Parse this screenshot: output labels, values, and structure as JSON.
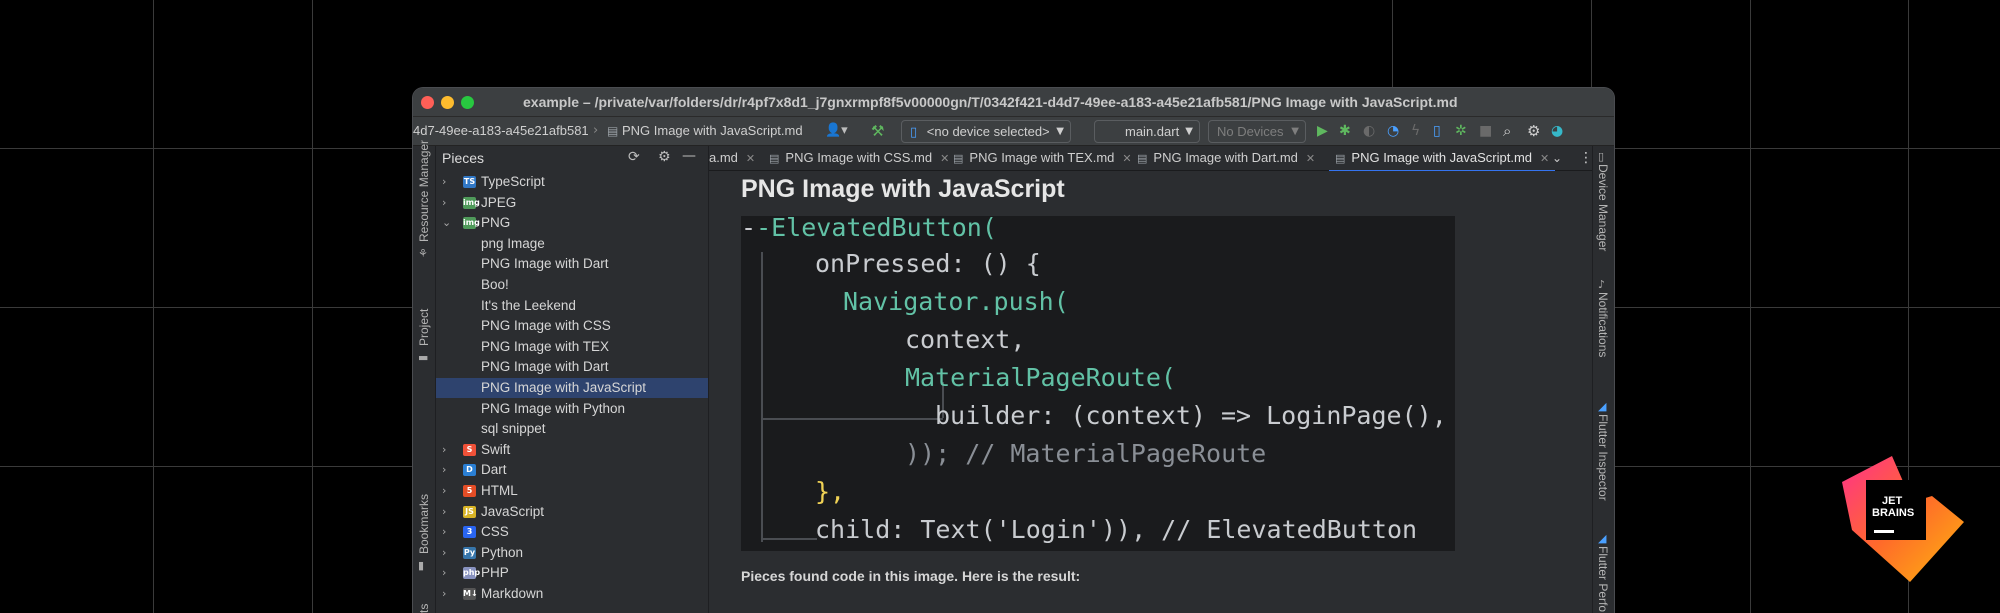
{
  "window": {
    "title": "example – /private/var/folders/dr/r4pf7x8d1_j7gnxrmpf8f5v00000gn/T/0342f421-d4d7-49ee-a183-a45e21afb581/PNG Image with JavaScript.md"
  },
  "toolbar": {
    "breadcrumb_folder": "4d7-49ee-a183-a45e21afb581",
    "breadcrumb_file": "PNG Image with JavaScript.md",
    "device_select": "<no device selected>",
    "run_config": "main.dart",
    "devices": "No Devices"
  },
  "sidebar_left": {
    "resource_manager": "Resource Manager",
    "project": "Project",
    "bookmarks": "Bookmarks",
    "structure": "ts"
  },
  "sidebar_right": {
    "device_manager": "Device Manager",
    "notifications": "Notifications",
    "flutter_inspector": "Flutter Inspector",
    "flutter_performance": "Flutter Perfo"
  },
  "pieces_panel": {
    "title": "Pieces",
    "tree": [
      {
        "label": "TypeScript",
        "expanded": false,
        "icon": "TS",
        "color": "#3178c6"
      },
      {
        "label": "JPEG",
        "expanded": false,
        "icon": "img",
        "color": "#4f9a5a"
      },
      {
        "label": "PNG",
        "expanded": true,
        "icon": "img",
        "color": "#4f9a5a"
      },
      {
        "label": "png Image",
        "child": true
      },
      {
        "label": "PNG Image with Dart",
        "child": true
      },
      {
        "label": "Boo!",
        "child": true
      },
      {
        "label": "It's the Leekend",
        "child": true
      },
      {
        "label": "PNG Image with CSS",
        "child": true
      },
      {
        "label": "PNG Image with TEX",
        "child": true
      },
      {
        "label": "PNG Image with Dart",
        "child": true
      },
      {
        "label": "PNG Image with JavaScript",
        "child": true,
        "selected": true
      },
      {
        "label": "PNG Image with Python",
        "child": true
      },
      {
        "label": "sql snippet",
        "child": true
      },
      {
        "label": "Swift",
        "expanded": false,
        "icon": "S",
        "color": "#f05138"
      },
      {
        "label": "Dart",
        "expanded": false,
        "icon": "D",
        "color": "#2a7fd4"
      },
      {
        "label": "HTML",
        "expanded": false,
        "icon": "5",
        "color": "#e44d26"
      },
      {
        "label": "JavaScript",
        "expanded": false,
        "icon": "JS",
        "color": "#d8b426"
      },
      {
        "label": "CSS",
        "expanded": false,
        "icon": "3",
        "color": "#2965f1"
      },
      {
        "label": "Python",
        "expanded": false,
        "icon": "Py",
        "color": "#3776ab"
      },
      {
        "label": "PHP",
        "expanded": false,
        "icon": "php",
        "color": "#8892bf"
      },
      {
        "label": "Markdown",
        "expanded": false,
        "icon": "M↓",
        "color": "#555"
      }
    ]
  },
  "tabs": [
    {
      "label": "a.md"
    },
    {
      "label": "PNG Image with CSS.md"
    },
    {
      "label": "PNG Image with TEX.md"
    },
    {
      "label": "PNG Image with Dart.md"
    },
    {
      "label": "PNG Image with JavaScript.md",
      "active": true
    }
  ],
  "markdown": {
    "heading": "PNG Image with JavaScript",
    "code_lines": [
      "-ElevatedButton(",
      "onPressed: () {",
      "Navigator.push(",
      "context,",
      "MaterialPageRoute(",
      "builder: (context) => LoginPage(),",
      ")); // MaterialPageRoute",
      "},",
      "child: Text('Login')), // ElevatedButton"
    ],
    "footer": "Pieces found code in this image. Here is the result:"
  },
  "logo": {
    "line1": "JET",
    "line2": "BRAINS"
  }
}
